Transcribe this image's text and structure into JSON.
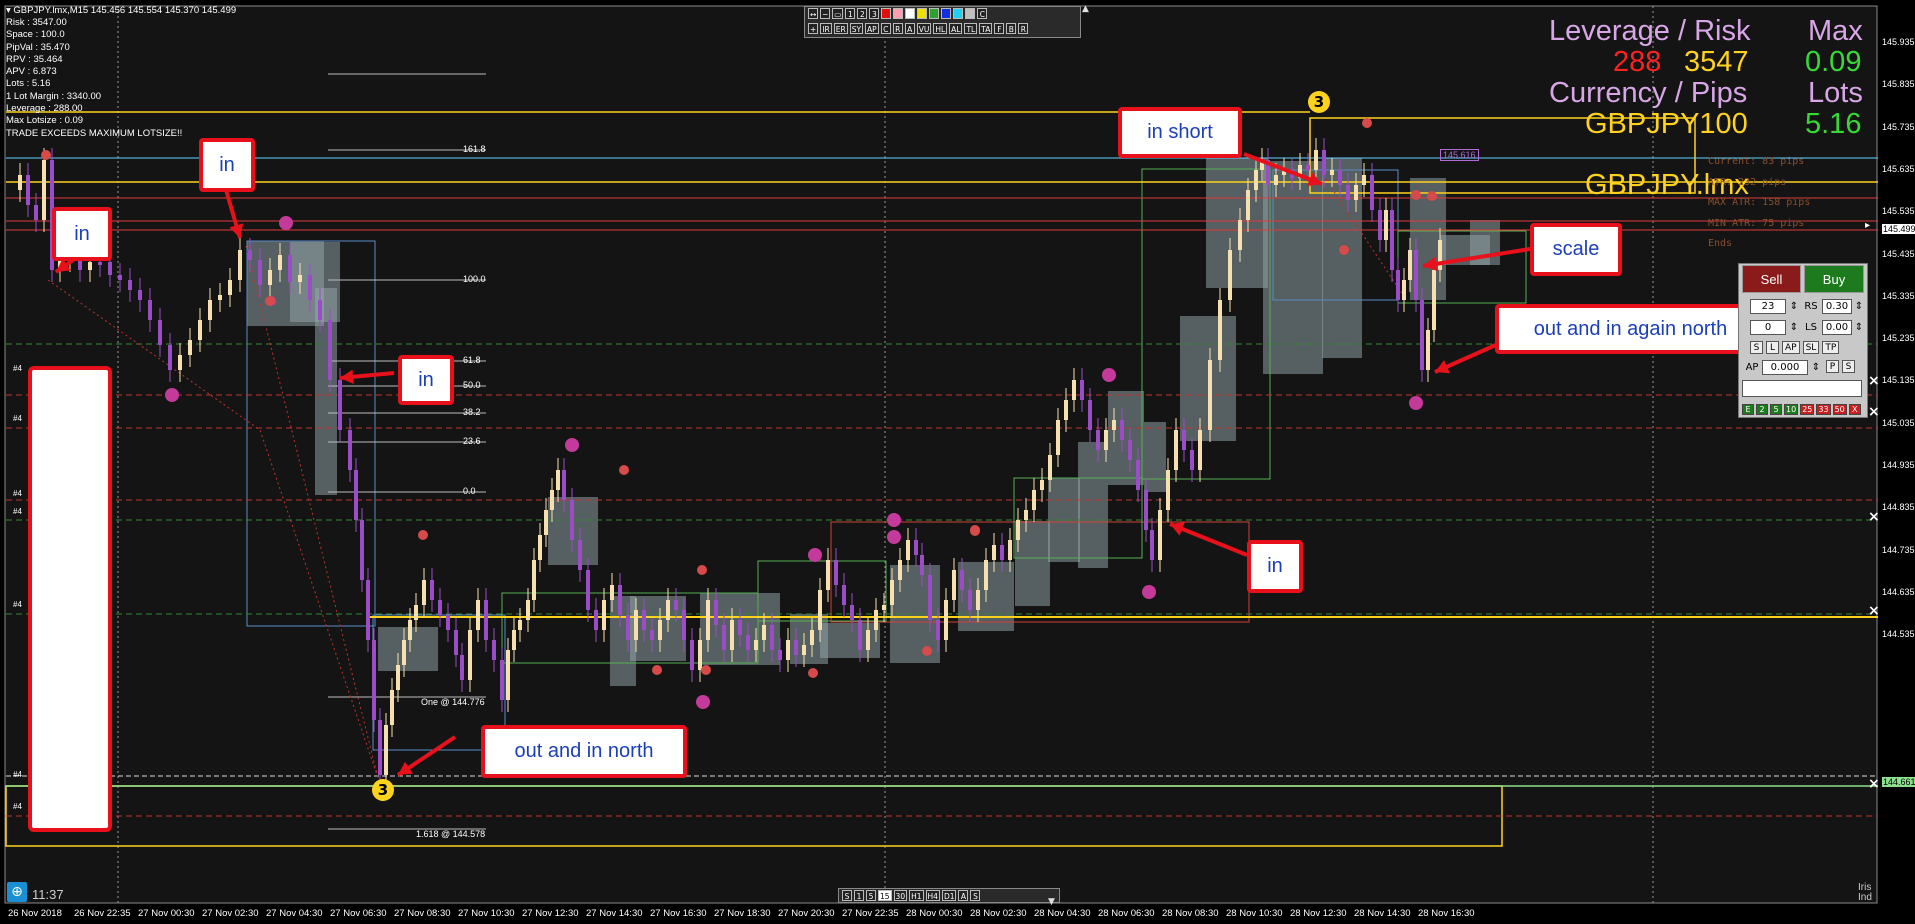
{
  "window_title": "GBPJPY.lmx,M15  145.456 145.554 145.370 145.499",
  "info_lines": [
    "Risk : 3547.00",
    "Space : 100.0",
    "PipVal : 35.470",
    "RPV : 35.464",
    "APV : 6.873",
    "Lots : 5.16",
    "1 Lot Margin : 3340.00",
    "Leverage : 288.00",
    "Max Lotsize : 0.09",
    "TRADE EXCEEDS MAXIMUM LOTSIZE!!"
  ],
  "callouts": [
    {
      "text": "in"
    },
    {
      "text": "in"
    },
    {
      "text": "in"
    },
    {
      "text": "out and in north"
    },
    {
      "text": "in short"
    },
    {
      "text": "scale"
    },
    {
      "text": "out and in again north"
    },
    {
      "text": "in"
    }
  ],
  "overlay": {
    "leverage_risk_label": "Leverage / Risk",
    "max_label": "Max",
    "leverage_value": "288",
    "risk_value": "3547",
    "max_value": "0.09",
    "currency_pips_label": "Currency / Pips",
    "lots_label": "Lots",
    "symbol_pips": "GBPJPY100",
    "lots_value": "5.16",
    "symbol": "GBPJPY.lmx",
    "colors": {
      "label": "#d8a6e6",
      "red": "#ff2020",
      "yellow": "#ffd21e",
      "green": "#37d937"
    }
  },
  "stats_lines": [
    "Current: 83 pips",
    "ATR: 232 pips",
    "MAX ATR: 158 pips",
    "MIN ATR: 75 pips",
    "Ends"
  ],
  "trade_panel": {
    "sell": "Sell",
    "buy": "Buy",
    "rs_label": "RS",
    "rs_value": "0.30",
    "ls_label": "LS",
    "ls_value": "0.00",
    "lot_value_1": "23",
    "lot_value_2": "0",
    "mode_buttons": [
      "S",
      "L",
      "AP",
      "SL",
      "TP"
    ],
    "ap_label": "AP",
    "ap_value": "0.000",
    "ap_buttons": [
      "P",
      "S"
    ],
    "bottom_buttons": [
      "E",
      "2",
      "5",
      "10",
      "25",
      "33",
      "50",
      "X"
    ]
  },
  "fib_levels": [
    "161.8",
    "100.0",
    "61.8",
    "50.0",
    "38.2",
    "23.6",
    "0.0"
  ],
  "fib_bottom_labels": {
    "one": "One @ 144.776",
    "ext": "1.618 @ 144.578"
  },
  "top_toolbar_row1": [
    "1",
    "2",
    "3",
    "C"
  ],
  "top_toolbar_row2": [
    "IR",
    "ER",
    "SY",
    "AP",
    "C",
    "R",
    "A",
    "VU",
    "HL",
    "AL",
    "TL",
    "TA",
    "F",
    "B",
    "R"
  ],
  "bottom_toolbar": [
    "S",
    "1",
    "5",
    "15",
    "30",
    "H1",
    "H4",
    "D1",
    "A",
    "S"
  ],
  "price_axis": [
    "145.935",
    "145.835",
    "145.735",
    "145.635",
    "145.535",
    "145.435",
    "145.335",
    "145.235",
    "145.135",
    "145.035",
    "144.935",
    "144.835",
    "144.735",
    "144.635",
    "144.535"
  ],
  "price_tags": {
    "high": "145.616",
    "ask": "145.499",
    "current": "144.661"
  },
  "time_axis": [
    "26 Nov 2018",
    "26 Nov 22:35",
    "27 Nov 00:30",
    "27 Nov 02:30",
    "27 Nov 04:30",
    "27 Nov 06:30",
    "27 Nov 08:30",
    "27 Nov 10:30",
    "27 Nov 12:30",
    "27 Nov 14:30",
    "27 Nov 16:30",
    "27 Nov 18:30",
    "27 Nov 20:30",
    "27 Nov 22:35",
    "28 Nov 00:30",
    "28 Nov 02:30",
    "28 Nov 04:30",
    "28 Nov 06:30",
    "28 Nov 08:30",
    "28 Nov 10:30",
    "28 Nov 12:30",
    "28 Nov 14:30",
    "28 Nov 16:30"
  ],
  "side_labels": [
    "#4",
    "#4",
    "#4",
    "#4",
    "#4",
    "#4",
    "#4"
  ],
  "clock": "11:37",
  "bottom_right": "Iris Ind",
  "markers": {
    "three": "3"
  }
}
